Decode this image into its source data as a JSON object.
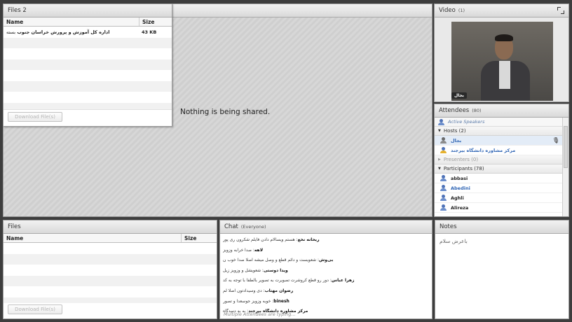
{
  "share": {
    "message": "Nothing is being shared."
  },
  "files2": {
    "title": "Files 2",
    "col_name": "Name",
    "col_size": "Size",
    "rows": [
      {
        "name": "اداره کل آموزش و پرورش خراسان جنوب",
        "size": "43 KB"
      }
    ],
    "download_label": "Download File(s)"
  },
  "video": {
    "title": "Video",
    "count": "(1)",
    "speaker_label": "بجال"
  },
  "attendees": {
    "title": "Attendees",
    "count": "(80)",
    "active_speakers": "Active Speakers",
    "hosts_label": "Hosts (2)",
    "hosts": [
      "بجال",
      "مرکز مشاوره دانشگاه بیرجند"
    ],
    "presenters_label": "Presenters (0)",
    "participants_label": "Participants (78)",
    "participants": [
      "abbasi",
      "Abedini",
      "Aghli",
      "Alireza"
    ]
  },
  "files": {
    "title": "Files",
    "col_name": "Name",
    "col_size": "Size",
    "download_label": "Download File(s)"
  },
  "chat": {
    "title": "Chat",
    "scope": "(Everyone)",
    "messages": [
      {
        "author": "ریحانه نخع",
        "text": "هستم ویسالام دادن فایلم شکرون ری پور"
      },
      {
        "author": "لاهه",
        "text": "صدا خرابه وزویز"
      },
      {
        "author": "بی‌وش",
        "text": "شعویست و دائم قطع و وصل میشه اصلا صدا خوب ن"
      },
      {
        "author": "ویدا دوستی",
        "text": "شعویشل و وزویز زیل"
      },
      {
        "author": "زهرا عباس",
        "text": "دور رو قطع کروشرت تصویرت به تصویر بالطفا با توجه به کد"
      },
      {
        "author": "رضوان مهتاب",
        "text": "دی وسیدادتون اصلا لم"
      },
      {
        "author": "binesh",
        "text": "خوبه وزویز جوسعدا و تصور"
      },
      {
        "author": "مرکز مشاوره دانشگاه بیرجند",
        "text": "به به دسدگاه"
      }
    ],
    "typing": "Multiple Attendees are typing..."
  },
  "notes": {
    "title": "Notes",
    "text": "باعرض سلام"
  }
}
